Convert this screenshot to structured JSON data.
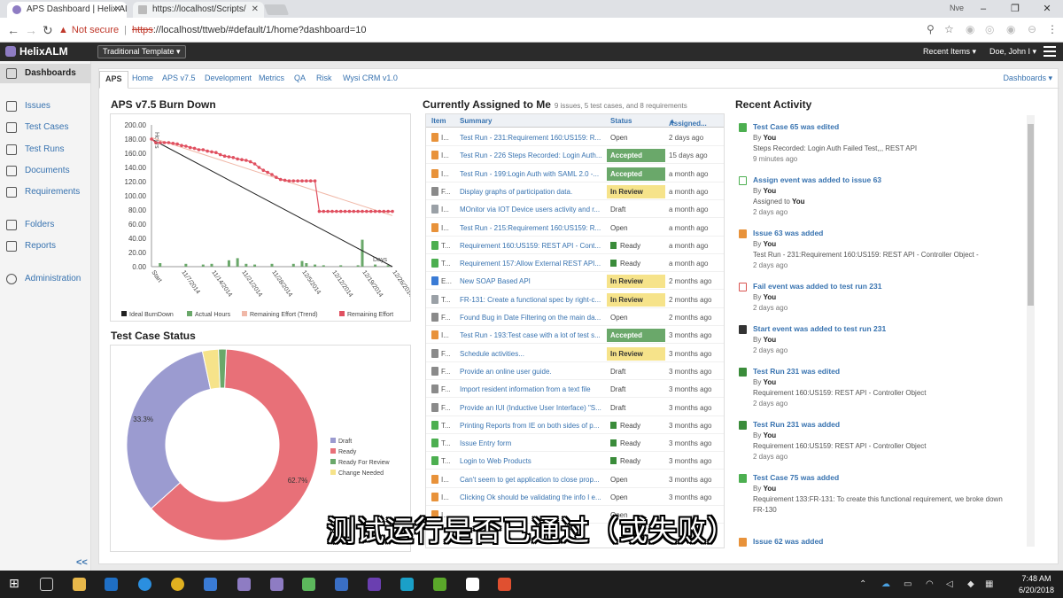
{
  "browser": {
    "tabs": [
      {
        "title": "APS Dashboard | Helix ALM",
        "favicon_color": "#8e7cc3"
      },
      {
        "title": "https://localhost/Scripts/",
        "favicon_color": "#888888"
      }
    ],
    "profile": "Nve",
    "address": {
      "warning": "Not secure",
      "scheme": "https",
      "rest": "://localhost/ttweb/#default/1/home?dashboard=10"
    }
  },
  "header": {
    "logo": "HelixALM",
    "template": "Traditional Template",
    "recent": "Recent Items",
    "user": "Doe, John I"
  },
  "sidebar": {
    "items": [
      {
        "label": "Dashboards"
      },
      {
        "label": "Issues"
      },
      {
        "label": "Test Cases"
      },
      {
        "label": "Test Runs"
      },
      {
        "label": "Documents"
      },
      {
        "label": "Requirements"
      },
      {
        "label": "Folders"
      },
      {
        "label": "Reports"
      },
      {
        "label": "Administration"
      }
    ],
    "collapse": "<<"
  },
  "tabs": [
    "APS",
    "Home",
    "APS v7.5",
    "Development",
    "Metrics",
    "QA",
    "Risk",
    "Wysi CRM v1.0"
  ],
  "dashboards_menu": "Dashboards",
  "burndown": {
    "title": "APS v7.5 Burn Down",
    "y_unit_label": "Hours",
    "x_unit_label": "Days"
  },
  "chart_data": [
    {
      "type": "line",
      "title": "APS v7.5 Burn Down",
      "ylabel": "Hours",
      "xlabel": "Days",
      "ylim": [
        0,
        200
      ],
      "yticks": [
        "200.00",
        "180.00",
        "160.00",
        "140.00",
        "120.00",
        "100.00",
        "80.00",
        "60.00",
        "40.00",
        "20.00",
        "0.00"
      ],
      "x_tick_labels": [
        "Start",
        "11/7/2014",
        "11/14/2014",
        "11/21/2014",
        "11/28/2014",
        "12/5/2014",
        "12/12/2014",
        "12/19/2014",
        "12/26/2014"
      ],
      "legend": [
        "Ideal BurnDown",
        "Actual Hours",
        "Remaining Effort (Trend)",
        "Remaining Effort"
      ],
      "legend_position": "bottom",
      "colors": {
        "ideal": "#222222",
        "actual": "#6aa86a",
        "trend": "#f0b8a8",
        "remaining": "#e05060"
      },
      "ideal": [
        [
          0,
          180
        ],
        [
          56,
          0
        ]
      ],
      "trend": [
        [
          0,
          182
        ],
        [
          56,
          72
        ]
      ],
      "remaining": [
        180,
        175,
        175,
        175,
        175,
        174,
        173,
        171,
        170,
        168,
        167,
        165,
        165,
        163,
        162,
        161,
        158,
        156,
        155,
        154,
        152,
        151,
        150,
        148,
        145,
        140,
        136,
        133,
        130,
        126,
        123,
        122,
        121,
        121,
        121,
        121,
        121,
        121,
        121,
        78,
        78,
        78,
        78,
        78,
        78,
        78,
        78,
        78,
        78,
        78,
        78,
        78,
        78,
        78,
        78,
        78,
        78
      ],
      "actual_bars": [
        [
          2,
          5
        ],
        [
          8,
          4
        ],
        [
          12,
          3
        ],
        [
          14,
          4
        ],
        [
          18,
          9
        ],
        [
          20,
          12
        ],
        [
          22,
          4
        ],
        [
          24,
          3
        ],
        [
          28,
          4
        ],
        [
          33,
          4
        ],
        [
          35,
          8
        ],
        [
          36,
          5
        ],
        [
          38,
          3
        ],
        [
          40,
          2
        ],
        [
          44,
          2
        ],
        [
          48,
          2
        ],
        [
          49,
          38
        ],
        [
          52,
          3
        ],
        [
          55,
          2
        ]
      ]
    },
    {
      "type": "pie",
      "title": "Test Case Status",
      "labels": [
        "Draft",
        "Ready",
        "Ready For Review",
        "Change Needed"
      ],
      "values": [
        33.3,
        62.7,
        1.3,
        2.7
      ],
      "data_labels": [
        "33.3%",
        "62.7%",
        "",
        ""
      ],
      "colors": [
        "#9b9bd0",
        "#e87078",
        "#6aa86a",
        "#f6e38a"
      ],
      "legend_position": "right"
    }
  ],
  "assigned": {
    "title": "Currently Assigned to Me",
    "subtitle": "9 issues, 5 test cases, and 8 requirements",
    "headers": [
      "Item",
      "Summary",
      "Status",
      "Assigned..."
    ],
    "rows": [
      {
        "icon": "issue",
        "item": "I...",
        "summary": "Test Run - 231:Requirement 160:US159: R...",
        "status": "Open",
        "style": "",
        "assigned": "2 days ago"
      },
      {
        "icon": "issue",
        "item": "I...",
        "summary": "Test Run - 226 Steps Recorded: Login Auth...",
        "status": "Accepted",
        "style": "acc",
        "assigned": "15 days ago"
      },
      {
        "icon": "issue",
        "item": "I...",
        "summary": "Test Run - 199:Login Auth with SAML 2.0 -...",
        "status": "Accepted",
        "style": "acc",
        "assigned": "a month ago"
      },
      {
        "icon": "feature",
        "item": "F...",
        "summary": "Display graphs of participation data.",
        "status": "In Review",
        "style": "rev",
        "assigned": "a month ago"
      },
      {
        "icon": "tool",
        "item": "I...",
        "summary": "MOnitor via IOT Device users activity and r...",
        "status": "Draft",
        "style": "",
        "assigned": "a month ago"
      },
      {
        "icon": "issue",
        "item": "I...",
        "summary": "Test Run - 215:Requirement 160:US159: R...",
        "status": "Open",
        "style": "",
        "assigned": "a month ago"
      },
      {
        "icon": "testcase",
        "item": "T...",
        "summary": "Requirement 160:US159: REST API - Cont...",
        "status": "Ready",
        "style": "flag",
        "assigned": "a month ago"
      },
      {
        "icon": "testcase",
        "item": "T...",
        "summary": "Requirement 157:Allow External REST API...",
        "status": "Ready",
        "style": "flag",
        "assigned": "a month ago"
      },
      {
        "icon": "epic",
        "item": "E...",
        "summary": "New SOAP Based API",
        "status": "In Review",
        "style": "rev",
        "assigned": "2 months ago"
      },
      {
        "icon": "tool",
        "item": "T...",
        "summary": "FR-131: Create a functional spec by right-c...",
        "status": "In Review",
        "style": "rev",
        "assigned": "2 months ago"
      },
      {
        "icon": "feature",
        "item": "F...",
        "summary": "Found Bug in Date Filtering on the main da...",
        "status": "Open",
        "style": "",
        "assigned": "2 months ago"
      },
      {
        "icon": "issue",
        "item": "I...",
        "summary": "Test Run - 193:Test case with a lot of test s...",
        "status": "Accepted",
        "style": "acc",
        "assigned": "3 months ago"
      },
      {
        "icon": "feature",
        "item": "F...",
        "summary": "Schedule activities...",
        "status": "In Review",
        "style": "rev",
        "assigned": "3 months ago"
      },
      {
        "icon": "feature",
        "item": "F...",
        "summary": "Provide an online user guide.",
        "status": "Draft",
        "style": "",
        "assigned": "3 months ago"
      },
      {
        "icon": "feature",
        "item": "F...",
        "summary": "Import resident information from a text file",
        "status": "Draft",
        "style": "",
        "assigned": "3 months ago"
      },
      {
        "icon": "feature",
        "item": "F...",
        "summary": "Provide an IUI (Inductive User Interface) \"S...",
        "status": "Draft",
        "style": "",
        "assigned": "3 months ago"
      },
      {
        "icon": "testcase",
        "item": "T...",
        "summary": "Printing Reports from IE on both sides of p...",
        "status": "Ready",
        "style": "flag",
        "assigned": "3 months ago"
      },
      {
        "icon": "testcase",
        "item": "T...",
        "summary": "Issue Entry form",
        "status": "Ready",
        "style": "flag",
        "assigned": "3 months ago"
      },
      {
        "icon": "testcase",
        "item": "T...",
        "summary": "Login to Web Products",
        "status": "Ready",
        "style": "flag",
        "assigned": "3 months ago"
      },
      {
        "icon": "issue",
        "item": "I...",
        "summary": "Can't seem to get application to close prop...",
        "status": "Open",
        "style": "",
        "assigned": "3 months ago"
      },
      {
        "icon": "issue",
        "item": "I...",
        "summary": "Clicking Ok should be validating the info I e...",
        "status": "Open",
        "style": "",
        "assigned": "3 months ago"
      },
      {
        "icon": "issue",
        "item": "I...",
        "summary": "",
        "status": "Open",
        "style": "",
        "assigned": ""
      }
    ]
  },
  "activity": {
    "title": "Recent Activity",
    "items": [
      {
        "icon": "testcase",
        "title": "Test Case 65 was edited",
        "by": "By",
        "who": "You",
        "detail": "Steps Recorded: Login Auth Failed Test,,, REST API",
        "when": "9 minutes ago",
        "assigned_to": ""
      },
      {
        "icon": "assign",
        "title": "Assign event was added to issue 63",
        "by": "By",
        "who": "You",
        "detail": "Assigned to",
        "assigned_to": "You",
        "when": "2 days ago"
      },
      {
        "icon": "issue",
        "title": "Issue 63 was added",
        "by": "By",
        "who": "You",
        "detail": "Test Run - 231:Requirement 160:US159: REST API - Controller Object -",
        "when": "2 days ago",
        "assigned_to": ""
      },
      {
        "icon": "fail",
        "title": "Fail event was added to test run 231",
        "by": "By",
        "who": "You",
        "detail": "",
        "when": "2 days ago",
        "assigned_to": ""
      },
      {
        "icon": "start",
        "title": "Start event was added to test run 231",
        "by": "By",
        "who": "You",
        "detail": "",
        "when": "2 days ago",
        "assigned_to": ""
      },
      {
        "icon": "testrun",
        "title": "Test Run 231 was edited",
        "by": "By",
        "who": "You",
        "detail": "Requirement 160:US159: REST API - Controller Object",
        "when": "2 days ago",
        "assigned_to": ""
      },
      {
        "icon": "testrun",
        "title": "Test Run 231 was added",
        "by": "By",
        "who": "You",
        "detail": "Requirement 160:US159: REST API - Controller Object",
        "when": "2 days ago",
        "assigned_to": ""
      },
      {
        "icon": "testcase",
        "title": "Test Case 75 was added",
        "by": "By",
        "who": "You",
        "detail": "Requirement 133:FR-131: To create this functional requirement, we broke down",
        "detail2": "FR-130",
        "when": "",
        "assigned_to": ""
      },
      {
        "icon": "issue",
        "title": "Issue 62 was added",
        "by": "By",
        "who": "You",
        "detail": "",
        "when": "",
        "assigned_to": ""
      }
    ]
  },
  "subtitle": "测试运行是否已通过（或失败）",
  "taskbar": {
    "time": "7:48 AM",
    "date": "6/20/2018"
  },
  "icon_colors": {
    "issue": "#e8923a",
    "feature": "#8a8a8a",
    "tool": "#9aa0a6",
    "testcase": "#4caf50",
    "epic": "#3a7bd5",
    "assign": "#4caf50",
    "fail": "#d9534f",
    "start": "#333333",
    "testrun": "#3a8c3a"
  }
}
